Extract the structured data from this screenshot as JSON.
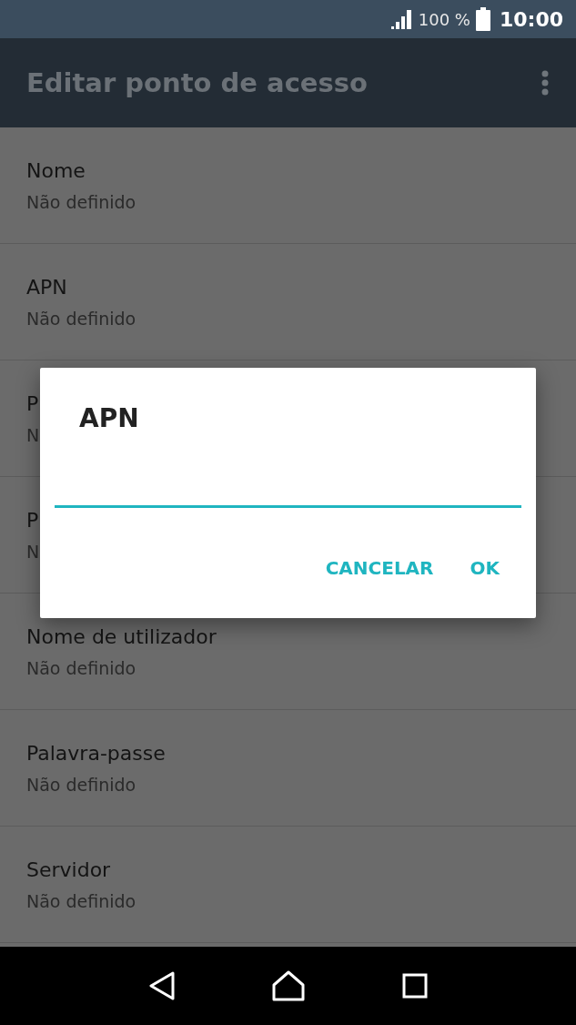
{
  "status_bar": {
    "battery": "100 %",
    "time": "10:00"
  },
  "app_bar": {
    "title": "Editar ponto de acesso"
  },
  "settings": [
    {
      "title": "Nome",
      "summary": "Não definido"
    },
    {
      "title": "APN",
      "summary": "Não definido"
    },
    {
      "title": "P",
      "summary": "N"
    },
    {
      "title": "P",
      "summary": "N"
    },
    {
      "title": "Nome de utilizador",
      "summary": "Não definido"
    },
    {
      "title": "Palavra-passe",
      "summary": "Não definido"
    },
    {
      "title": "Servidor",
      "summary": "Não definido"
    }
  ],
  "dialog": {
    "title": "APN",
    "buttons": [
      "CANCELAR",
      "OK"
    ]
  }
}
